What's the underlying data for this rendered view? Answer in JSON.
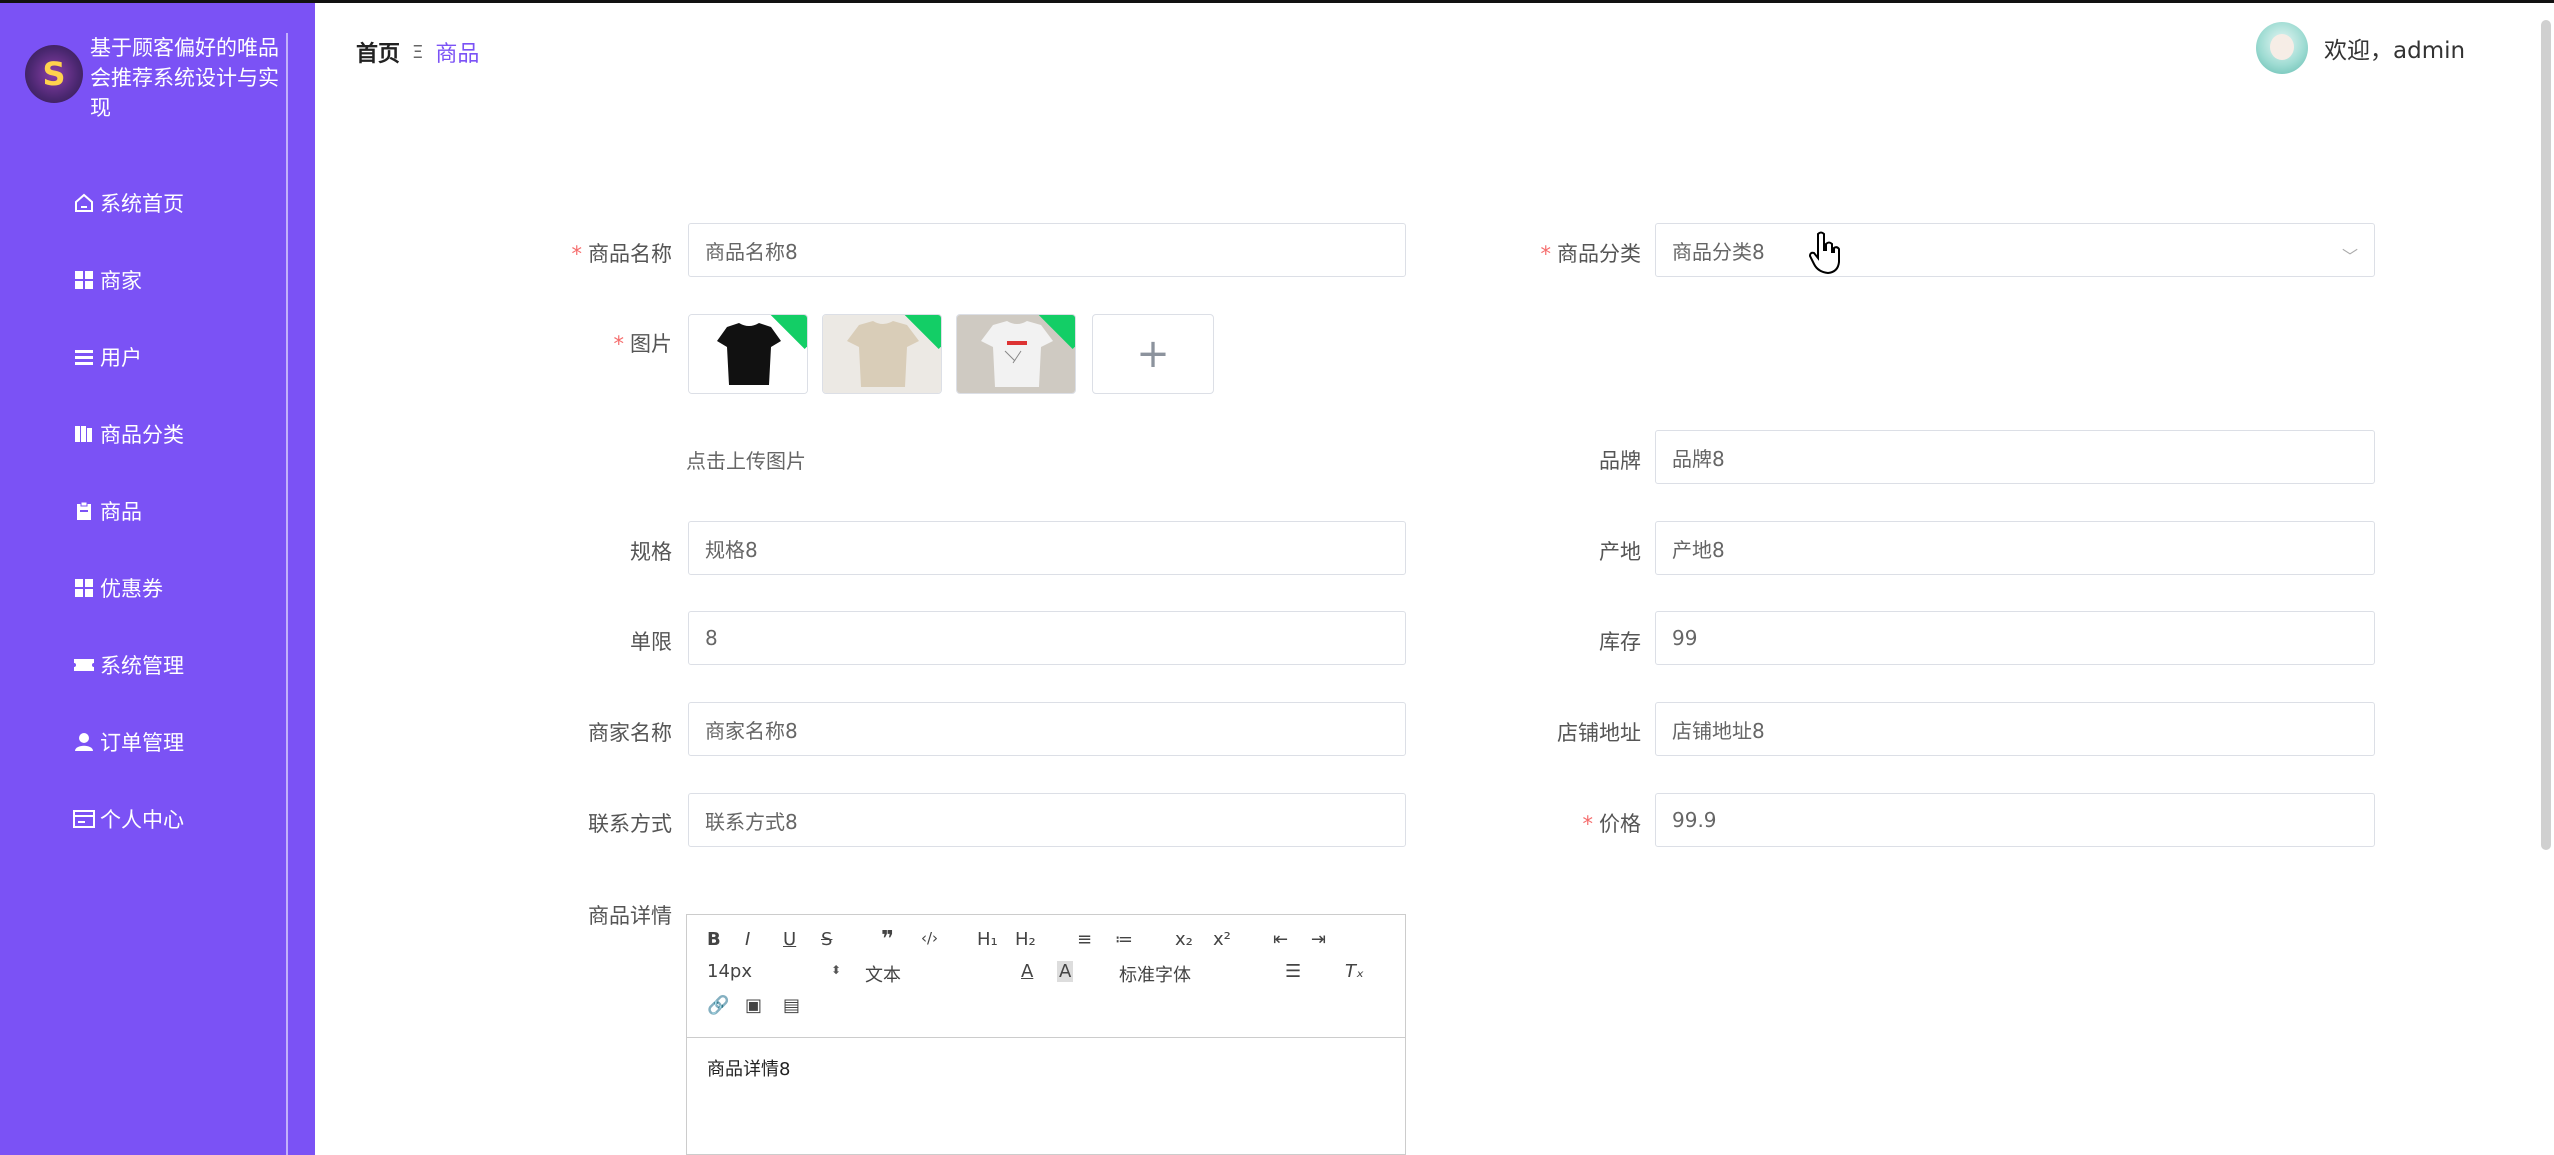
{
  "app": {
    "title": "基于顾客偏好的唯品会推荐系统设计与实现",
    "accent_color": "#7B52F5",
    "logo_icon": "logo-icon"
  },
  "sidebar": {
    "items": [
      {
        "label": "系统首页",
        "icon": "home-icon"
      },
      {
        "label": "商家",
        "icon": "grid-icon"
      },
      {
        "label": "用户",
        "icon": "list-icon"
      },
      {
        "label": "商品分类",
        "icon": "book-icon"
      },
      {
        "label": "商品",
        "icon": "clipboard-icon"
      },
      {
        "label": "优惠券",
        "icon": "grid-icon"
      },
      {
        "label": "系统管理",
        "icon": "ticket-icon"
      },
      {
        "label": "订单管理",
        "icon": "user-icon"
      },
      {
        "label": "个人中心",
        "icon": "card-icon"
      }
    ]
  },
  "header": {
    "breadcrumb_home": "首页",
    "breadcrumb_separator": "Ξ",
    "breadcrumb_current": "商品",
    "welcome": "欢迎，admin"
  },
  "form": {
    "name_label": "商品名称",
    "name_value": "商品名称8",
    "category_label": "商品分类",
    "category_value": "商品分类8",
    "image_label": "图片",
    "upload_hint": "点击上传图片",
    "upload_icon": "plus-icon",
    "brand_label": "品牌",
    "brand_value": "品牌8",
    "spec_label": "规格",
    "spec_value": "规格8",
    "origin_label": "产地",
    "origin_value": "产地8",
    "limit_label": "单限",
    "limit_value": "8",
    "stock_label": "库存",
    "stock_value": "99",
    "merchant_label": "商家名称",
    "merchant_value": "商家名称8",
    "address_label": "店铺地址",
    "address_value": "店铺地址8",
    "contact_label": "联系方式",
    "contact_value": "联系方式8",
    "price_label": "价格",
    "price_value": "99.9",
    "detail_label": "商品详情",
    "required_mark": "*"
  },
  "images": [
    {
      "name": "black-tshirt",
      "shirt_color": "#111111"
    },
    {
      "name": "beige-tshirt",
      "shirt_color": "#d9cdb8"
    },
    {
      "name": "white-print-tshirt",
      "shirt_color": "#f2f2f2"
    }
  ],
  "editor": {
    "toolbar_row1": [
      "B",
      "I",
      "U",
      "S",
      "❞",
      "‹/›",
      "H₁",
      "H₂",
      "≡",
      "≔",
      "x₂",
      "x²",
      "⇤",
      "⇥"
    ],
    "size_value": "14px",
    "header_value": "文本",
    "font_value": "标准字体",
    "content": "商品详情8"
  }
}
